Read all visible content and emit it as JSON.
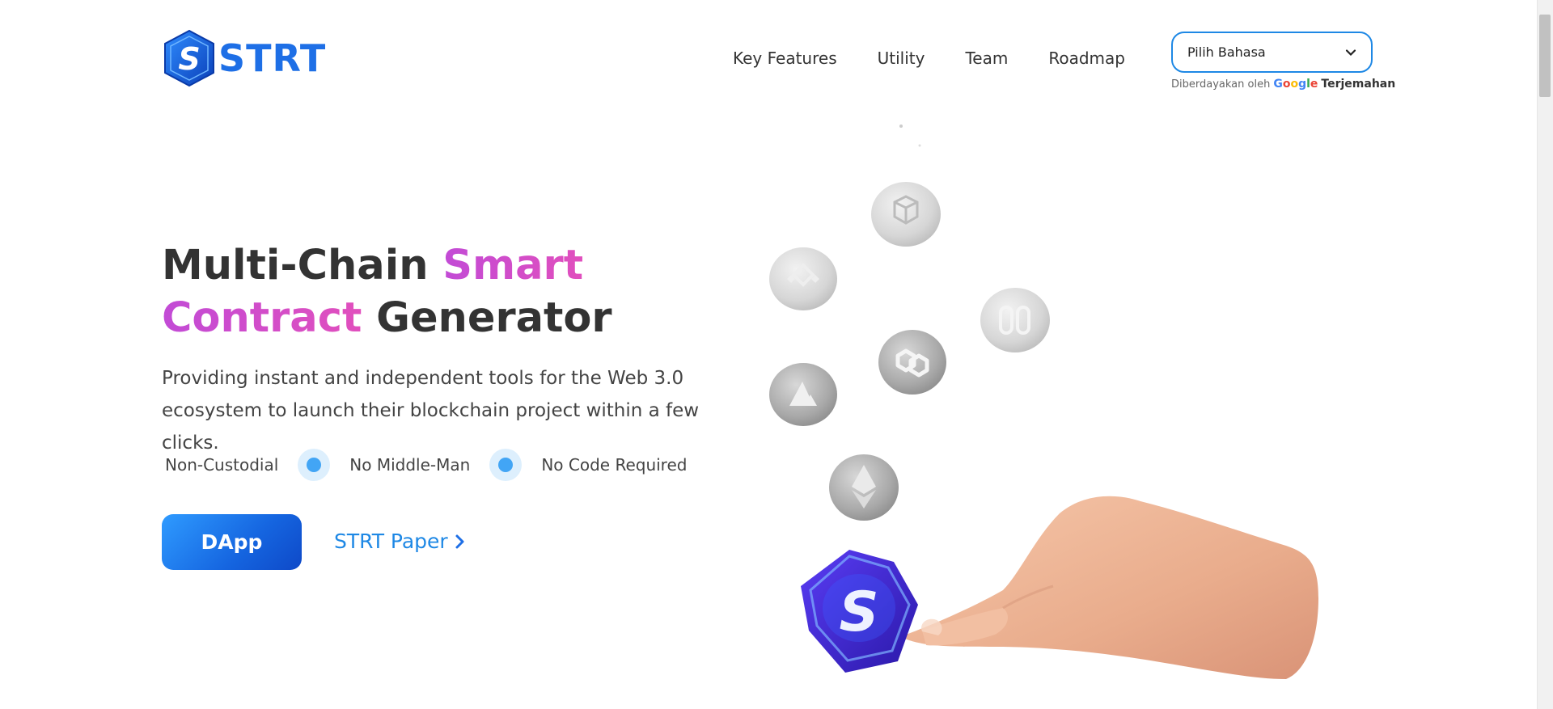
{
  "header": {
    "logo_text": "STRT",
    "nav": [
      "Key Features",
      "Utility",
      "Team",
      "Roadmap"
    ]
  },
  "language": {
    "selected": "Pilih Bahasa",
    "powered_by": "Diberdayakan oleh",
    "google": "Google",
    "translate": "Terjemahan"
  },
  "hero": {
    "title_part1": "Multi-Chain ",
    "title_accent1": "Smart",
    "title_accent2": "Contract",
    "title_part2": " Generator",
    "description": "Providing instant and independent tools for the Web 3.0 ecosystem to launch their blockchain project within a few clicks.",
    "features": [
      "Non-Custodial",
      "No Middle-Man",
      "No Code Required"
    ],
    "primary_button": "DApp",
    "secondary_link": "STRT Paper"
  },
  "colors": {
    "brand_blue": "#1e6fe6",
    "accent_pink": "#d14fd4",
    "link_blue": "#1e88e5"
  },
  "icons": [
    "strt-logo-icon",
    "chevron-down-icon",
    "chevron-right-icon",
    "filecoin-coin-icon",
    "binance-coin-icon",
    "hedera-coin-icon",
    "polygon-coin-icon",
    "avalanche-coin-icon",
    "ethereum-coin-icon",
    "strt-token-icon",
    "hand-illustration"
  ]
}
